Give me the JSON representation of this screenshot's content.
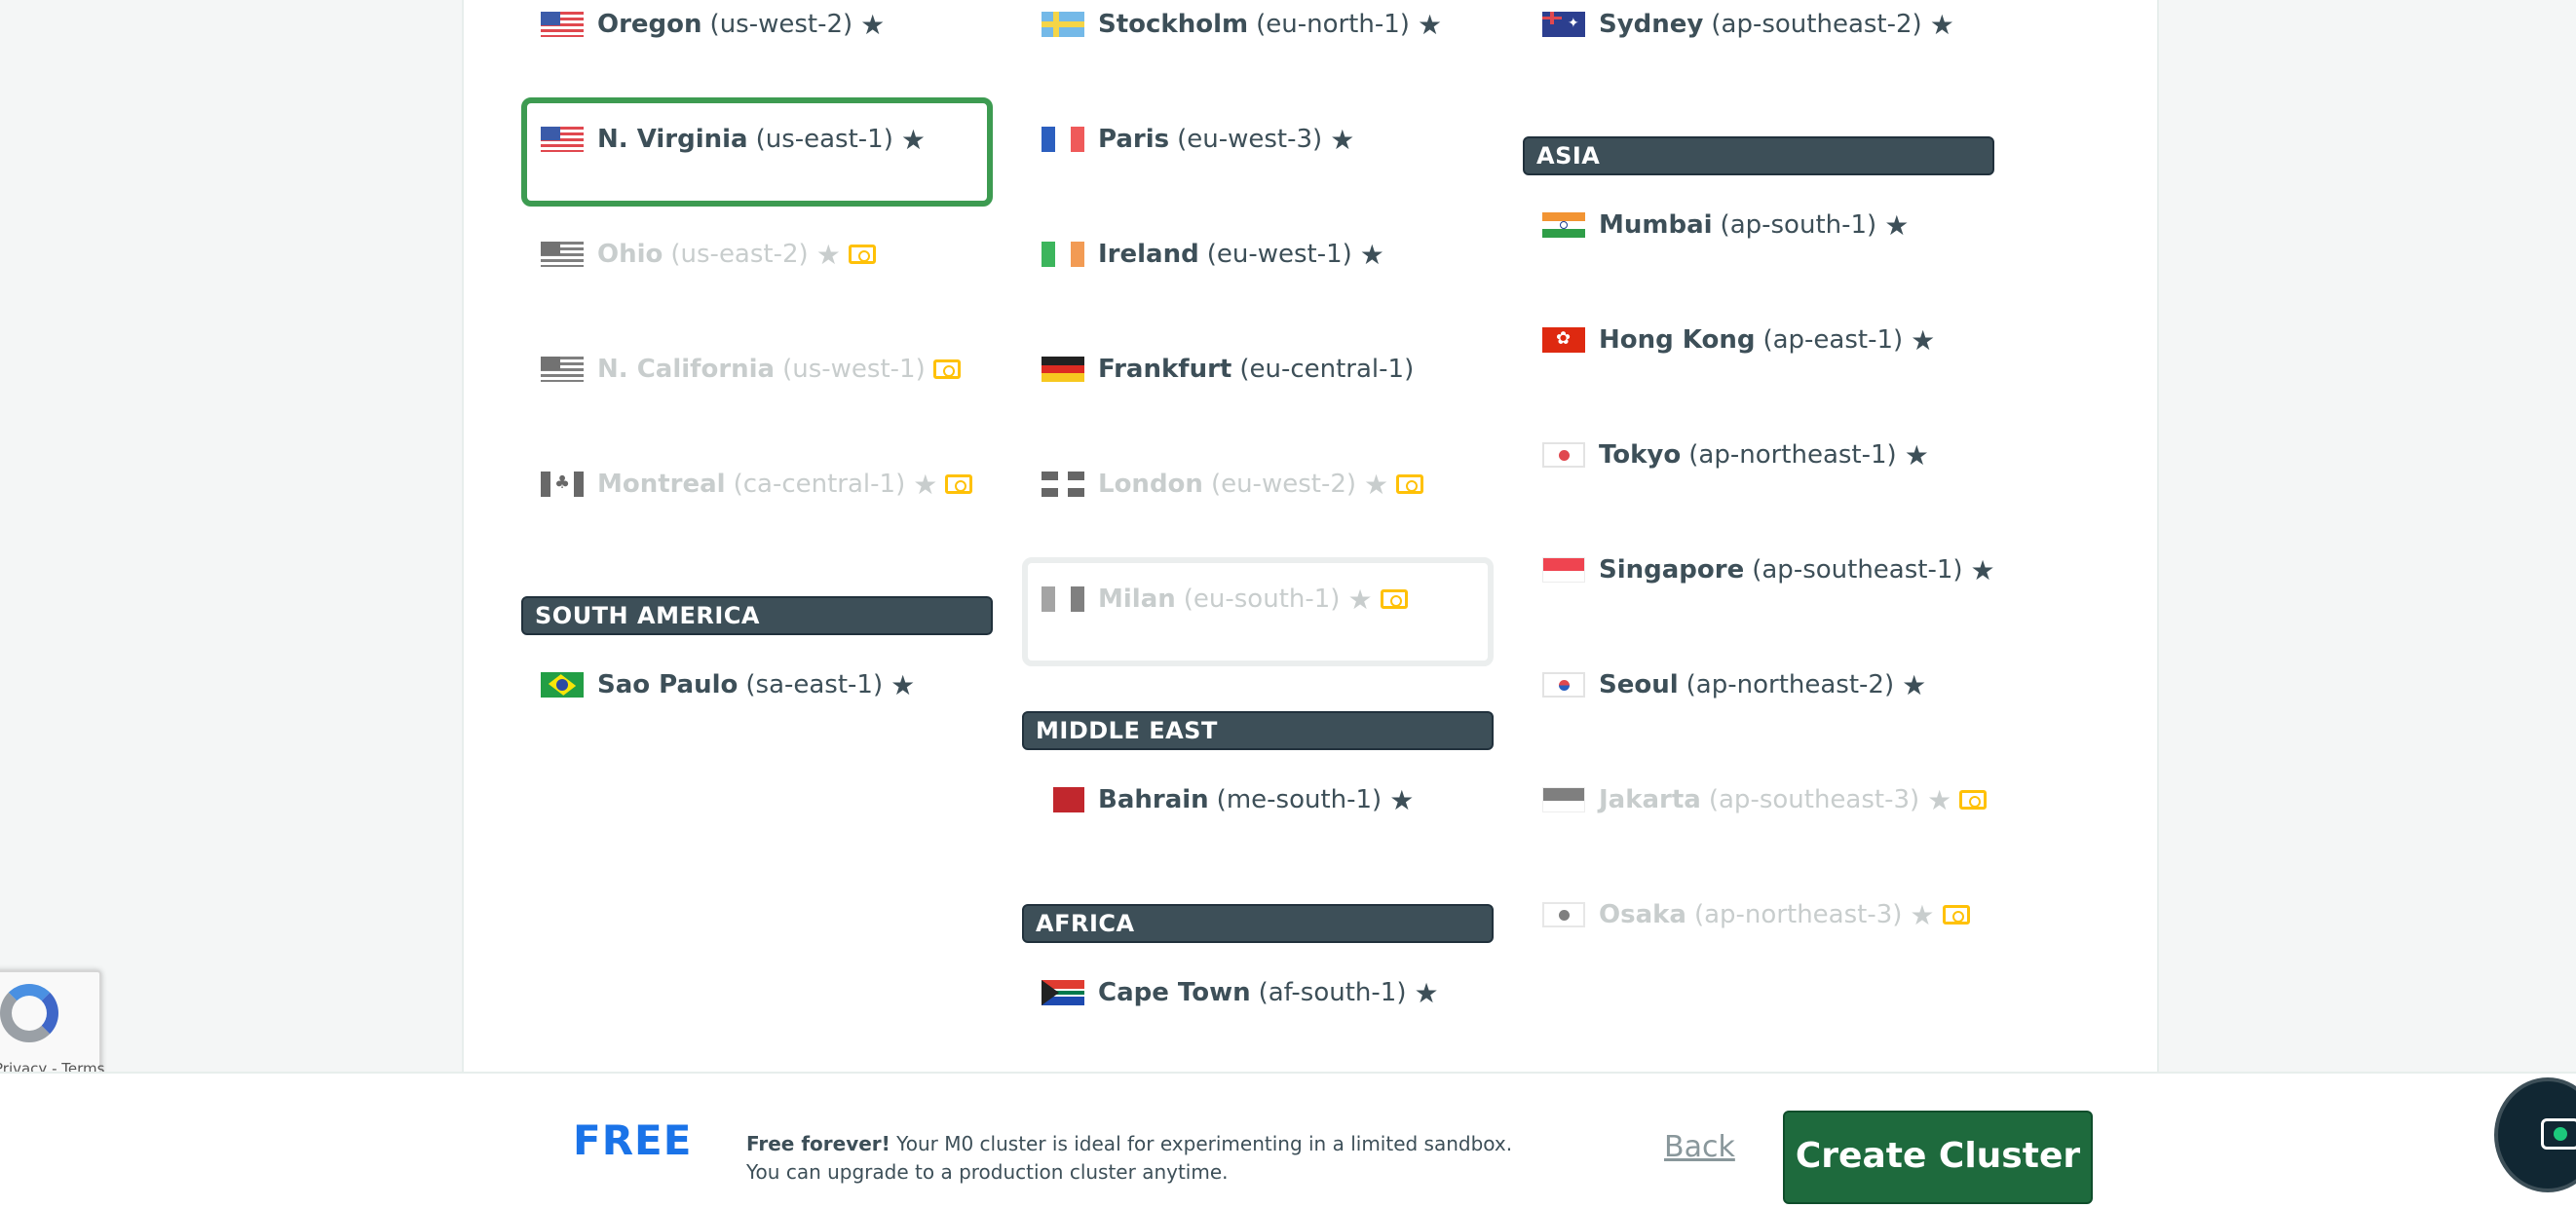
{
  "columns": {
    "left": {
      "regions_top": [
        {
          "name": "Oregon",
          "code": "(us-west-2)",
          "flag": "us",
          "star": true,
          "money": false,
          "disabled": false,
          "selected": false
        },
        {
          "name": "N. Virginia",
          "code": "(us-east-1)",
          "flag": "us",
          "star": true,
          "money": false,
          "disabled": false,
          "selected": true
        },
        {
          "name": "Ohio",
          "code": "(us-east-2)",
          "flag": "us",
          "star": true,
          "money": true,
          "disabled": true,
          "selected": false
        },
        {
          "name": "N. California",
          "code": "(us-west-1)",
          "flag": "us",
          "star": false,
          "money": true,
          "disabled": true,
          "selected": false
        },
        {
          "name": "Montreal",
          "code": "(ca-central-1)",
          "flag": "ca",
          "star": true,
          "money": true,
          "disabled": true,
          "selected": false
        }
      ],
      "section": "SOUTH AMERICA",
      "regions_bottom": [
        {
          "name": "Sao Paulo",
          "code": "(sa-east-1)",
          "flag": "br",
          "star": true,
          "money": false,
          "disabled": false,
          "selected": false
        }
      ]
    },
    "middle": {
      "regions_top": [
        {
          "name": "Stockholm",
          "code": "(eu-north-1)",
          "flag": "se",
          "star": true,
          "money": false,
          "disabled": false,
          "selected": false
        },
        {
          "name": "Paris",
          "code": "(eu-west-3)",
          "flag": "fr",
          "star": true,
          "money": false,
          "disabled": false,
          "selected": false
        },
        {
          "name": "Ireland",
          "code": "(eu-west-1)",
          "flag": "ie",
          "star": true,
          "money": false,
          "disabled": false,
          "selected": false
        },
        {
          "name": "Frankfurt",
          "code": "(eu-central-1)",
          "flag": "de",
          "star": false,
          "money": false,
          "disabled": false,
          "selected": false
        },
        {
          "name": "London",
          "code": "(eu-west-2)",
          "flag": "gb",
          "star": true,
          "money": true,
          "disabled": true,
          "selected": false
        },
        {
          "name": "Milan",
          "code": "(eu-south-1)",
          "flag": "it",
          "star": true,
          "money": true,
          "disabled": true,
          "selected": false
        }
      ],
      "section_me": "MIDDLE EAST",
      "regions_me": [
        {
          "name": "Bahrain",
          "code": "(me-south-1)",
          "flag": "bh",
          "star": true,
          "money": false,
          "disabled": false,
          "selected": false
        }
      ],
      "section_af": "AFRICA",
      "regions_af": [
        {
          "name": "Cape Town",
          "code": "(af-south-1)",
          "flag": "za",
          "star": true,
          "money": false,
          "disabled": false,
          "selected": false
        }
      ]
    },
    "right": {
      "regions_top": [
        {
          "name": "Sydney",
          "code": "(ap-southeast-2)",
          "flag": "au",
          "star": true,
          "money": false,
          "disabled": false,
          "selected": false
        }
      ],
      "section": "ASIA",
      "regions_bottom": [
        {
          "name": "Mumbai",
          "code": "(ap-south-1)",
          "flag": "in",
          "star": true,
          "money": false,
          "disabled": false,
          "selected": false
        },
        {
          "name": "Hong Kong",
          "code": "(ap-east-1)",
          "flag": "hk",
          "star": true,
          "money": false,
          "disabled": false,
          "selected": false
        },
        {
          "name": "Tokyo",
          "code": "(ap-northeast-1)",
          "flag": "jp",
          "star": true,
          "money": false,
          "disabled": false,
          "selected": false
        },
        {
          "name": "Singapore",
          "code": "(ap-southeast-1)",
          "flag": "sg",
          "star": true,
          "money": false,
          "disabled": false,
          "selected": false
        },
        {
          "name": "Seoul",
          "code": "(ap-northeast-2)",
          "flag": "kr",
          "star": true,
          "money": false,
          "disabled": false,
          "selected": false
        },
        {
          "name": "Jakarta",
          "code": "(ap-southeast-3)",
          "flag": "id",
          "star": true,
          "money": true,
          "disabled": true,
          "selected": false
        },
        {
          "name": "Osaka",
          "code": "(ap-northeast-3)",
          "flag": "jp",
          "star": true,
          "money": true,
          "disabled": true,
          "selected": false
        }
      ]
    }
  },
  "footer": {
    "tier": "FREE",
    "desc_bold": "Free forever!",
    "desc_rest": " Your M0 cluster is ideal for experimenting in a limited sandbox. You can upgrade to a production cluster anytime.",
    "back_label": "Back",
    "create_label": "Create Cluster"
  },
  "recaptcha": {
    "text": "Privacy - Terms"
  },
  "icons": {
    "star": "star-icon",
    "money": "paid-tier-icon",
    "chat": "chat-icon",
    "recaptcha": "recaptcha-icon"
  },
  "colors": {
    "selected_border": "#3d9b51",
    "section_bg": "#3d4f58",
    "primary_button": "#1e6a3d",
    "free_text": "#1a73e8"
  }
}
